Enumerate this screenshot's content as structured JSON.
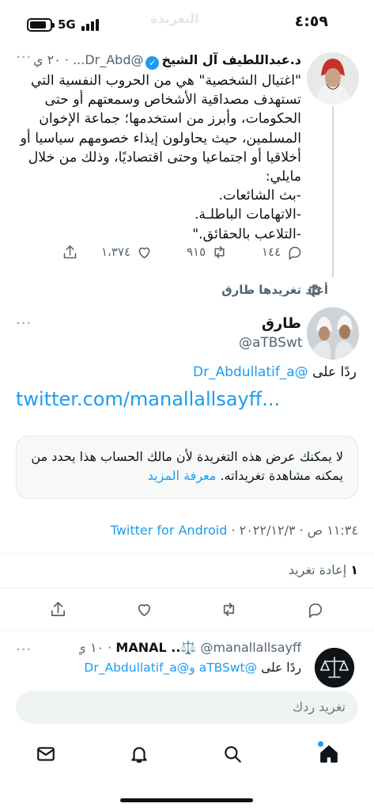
{
  "status_bar": {
    "time": "٤:٥٩",
    "network": "5G",
    "battery_level": 0.85,
    "screen_title": "التغريدة"
  },
  "thread_tweet": {
    "author_name": "د.عبداللطيف آل الشيخ",
    "author_handle": "@Dr_Abd...",
    "time_ago": "٢٠ ي",
    "avatar_icon": "person-avatar",
    "text": "\"اغتيال الشخصية\" هي من الحروب النفسية التي\nتستهدف مصداقية الأشخاص وسمعتهم أو حتى\nالحكومات، وأبرز من استخدمها؛ جماعة الإخوان\nالمسلمين، حيث يحاولون إيذاء خصومهم سياسيا أو\nأخلاقيا أو اجتماعيا وحتى اقتصاديًا، وذلك من خلال\nمايلي:\n-بث الشائعات.\n-الاتهامات الباطلـة.\n-التلاعب بالحقائق.\"",
    "replies": "١٤٤",
    "retweets": "٩١٥",
    "likes": "١،٣٧٤"
  },
  "retweeted_by": "أعاد تغريدها طارق",
  "main_tweet": {
    "author_name": "طارق",
    "author_handle": "@aTBSwt",
    "reply_prefix": "ردًا على",
    "reply_to": "@Dr_Abdullatif_a",
    "link": "twitter.com/manallallsayff...",
    "notice_text": "لا يمكنك عرض هذه التغريدة لأن مالك الحساب هذا يحدد من يمكنه مشاهدة تغريداته.",
    "notice_link": "معرفة المزيد",
    "timestamp": "١١:٣٤ ص · ٢٠٢٢/١٢/٣ ·",
    "source": "Twitter for Android",
    "retweet_count": "١",
    "retweet_label": "إعادة تغريد"
  },
  "reply_tweet": {
    "author_name": "MANAL ..⚖️",
    "author_handle": "@manallallsayff",
    "time_ago": "١٠ ي",
    "reply_prefix": "ردًا على",
    "reply_to": "@aTBSwt و@Dr_Abdullatif_a"
  },
  "compose": {
    "placeholder": "تغريد ردك"
  },
  "nav": {
    "items": [
      "home-icon",
      "search-icon",
      "notifications-icon",
      "messages-icon"
    ]
  },
  "colors": {
    "accent": "#1d9bf0",
    "muted": "#536471",
    "text": "#0f1419"
  }
}
